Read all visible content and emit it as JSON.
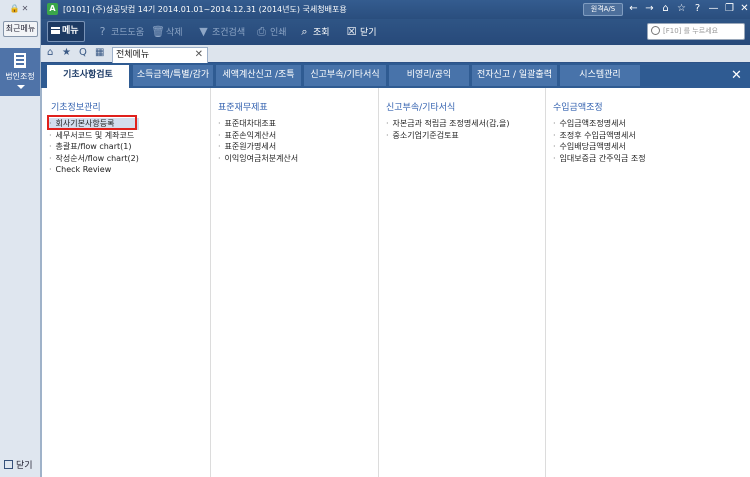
{
  "sidebar": {
    "recent_label": "최근메뉴",
    "corp_label": "법인조정",
    "close_label": "닫기"
  },
  "titlebar": {
    "app_badge": "A",
    "company_info": "[0101] (주)성공닷컴    14기  2014.01.01~2014.12.31  (2014년도)  국세청배포용",
    "remote_label": "원격A/S"
  },
  "toolbar": {
    "menu_label": "메뉴",
    "help_label": "코드도움",
    "delete_label": "삭제",
    "filter_label": "조건검색",
    "print_label": "인쇄",
    "query_label": "조회",
    "close_label": "닫기",
    "search_placeholder": "[F10] 를 누르세요"
  },
  "tabstrip": {
    "tab_label": "전체메뉴"
  },
  "categories": [
    {
      "label": "기초사항검토"
    },
    {
      "label": "소득금액/특별/감가"
    },
    {
      "label": "세액계산신고 /조특"
    },
    {
      "label": "신고부속/기타서식"
    },
    {
      "label": "비영리/공익"
    },
    {
      "label": "전자신고 / 일괄출력"
    },
    {
      "label": "시스템관리"
    }
  ],
  "columns": [
    {
      "title": "기초정보관리",
      "items": [
        "회사기본사항등록",
        "세무서코드 및 계좌코드",
        "총괄표/flow chart(1)",
        "작성순서/flow chart(2)",
        "Check Review"
      ]
    },
    {
      "title": "표준재무제표",
      "items": [
        "표준대차대조표",
        "표준손익계산서",
        "표준원가명세서",
        "이익잉여금처분계산서"
      ]
    },
    {
      "title": "신고부속/기타서식",
      "items": [
        "자본금과 적립금 조정명세서(갑,을)",
        "중소기업기준검토표"
      ]
    },
    {
      "title": "수입금액조정",
      "items": [
        "수입금액조정명세서",
        "조정후 수입금액명세서",
        "수입배당금액명세서",
        "임대보증금 간주익금 조정"
      ]
    }
  ],
  "colors": {
    "accent": "#2f5b92",
    "highlight": "#e0201c",
    "column_title": "#3563b0"
  }
}
